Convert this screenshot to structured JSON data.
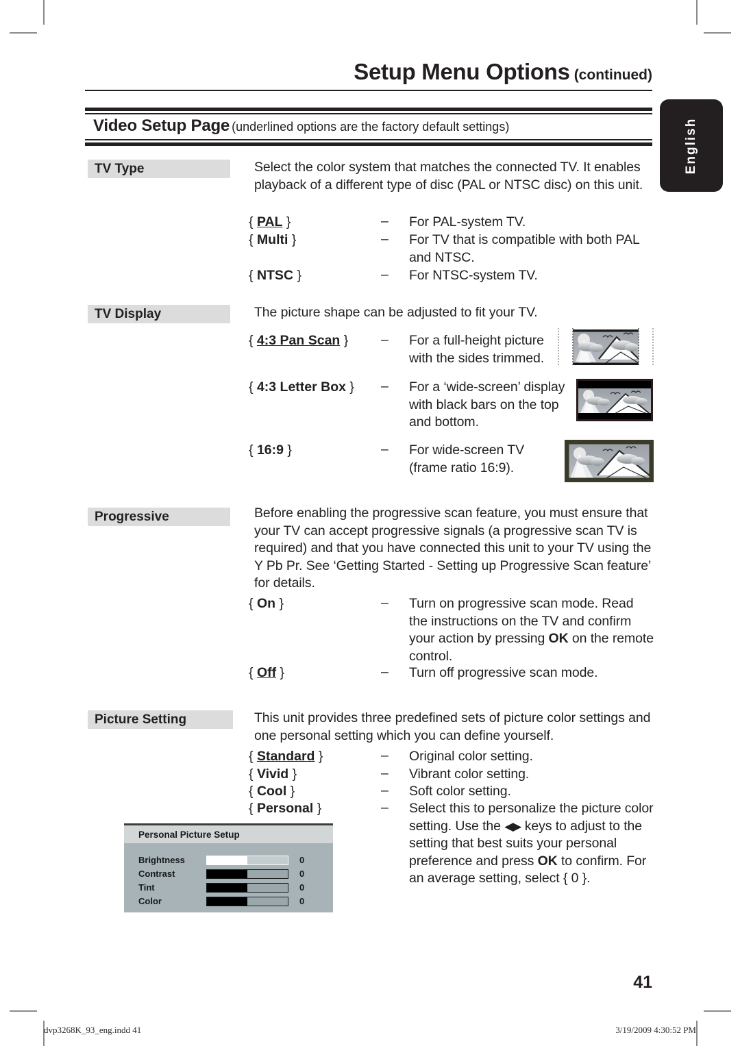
{
  "marks": {
    "label": "printer-crop-marks"
  },
  "header": {
    "title_main": "Setup Menu Options",
    "title_continued": "(continued)",
    "band_title": "Video Setup Page",
    "band_note": "(underlined options are the factory default settings)",
    "language_tab": "English"
  },
  "sections": [
    {
      "label": "TV Type",
      "intro": "Select the color system that matches the connected TV. It enables playback of a different type of disc (PAL or NTSC disc) on this unit.",
      "options": [
        {
          "term": "PAL",
          "default": true,
          "dash": "–",
          "desc": "For PAL-system TV."
        },
        {
          "term": "Multi",
          "default": false,
          "dash": "–",
          "desc": "For TV that is compatible with both PAL and NTSC."
        },
        {
          "term": "NTSC",
          "default": false,
          "dash": "–",
          "desc": "For NTSC-system TV."
        }
      ]
    },
    {
      "label": "TV Display",
      "intro": "The picture shape can be adjusted to fit your TV.",
      "options": [
        {
          "term": "4:3 Pan Scan",
          "default": true,
          "dash": "–",
          "desc": "For a full-height picture with the sides trimmed.",
          "thumb": "pan-scan"
        },
        {
          "term": "4:3 Letter Box",
          "default": false,
          "dash": "–",
          "desc": "For a ‘wide-screen’ display with black bars on the top and bottom.",
          "thumb": "letter-box"
        },
        {
          "term": "16:9",
          "default": false,
          "dash": "–",
          "desc": "For wide-screen TV (frame ratio 16:9).",
          "thumb": "wide-screen"
        }
      ]
    },
    {
      "label": "Progressive",
      "intro": "Before enabling the progressive scan feature, you must ensure that your TV can accept progressive signals (a progressive scan TV is required) and that you have connected this unit to your TV using the Y Pb Pr. See ‘Getting Started - Setting up Progressive Scan feature’ for details.",
      "options": [
        {
          "term": "On",
          "default": false,
          "dash": "–",
          "desc_pre": "Turn on progressive scan mode. Read the instructions on the TV and confirm your action by pressing ",
          "desc_bold": "OK",
          "desc_post": " on the remote control."
        },
        {
          "term": "Off",
          "default": true,
          "dash": "–",
          "desc": "Turn off progressive scan mode."
        }
      ]
    },
    {
      "label": "Picture Setting",
      "intro": "This unit provides three predefined sets of picture color settings and one personal setting which you can define yourself.",
      "options": [
        {
          "term": "Standard",
          "default": true,
          "dash": "–",
          "desc": "Original color setting."
        },
        {
          "term": "Vivid",
          "default": false,
          "dash": "–",
          "desc": "Vibrant color setting."
        },
        {
          "term": "Cool",
          "default": false,
          "dash": "–",
          "desc": "Soft color setting."
        },
        {
          "term": "Personal",
          "default": false,
          "dash": "–",
          "desc_pre": "Select this to personalize the picture color setting. Use the ",
          "desc_keys": "◀▶",
          "desc_mid": " keys to adjust to the setting that best suits your personal preference and press ",
          "desc_bold": "OK",
          "desc_post": " to confirm. For an average setting, select { 0 }."
        }
      ]
    }
  ],
  "osd": {
    "title": "Personal Picture Setup",
    "rows": [
      {
        "name": "Brightness",
        "value": "0",
        "selected": true
      },
      {
        "name": "Contrast",
        "value": "0",
        "selected": false
      },
      {
        "name": "Tint",
        "value": "0",
        "selected": false
      },
      {
        "name": "Color",
        "value": "0",
        "selected": false
      }
    ]
  },
  "page_number": "41",
  "footer": {
    "file": "dvp3268K_93_eng.indd   41",
    "timestamp": "3/19/2009   4:30:52 PM"
  }
}
